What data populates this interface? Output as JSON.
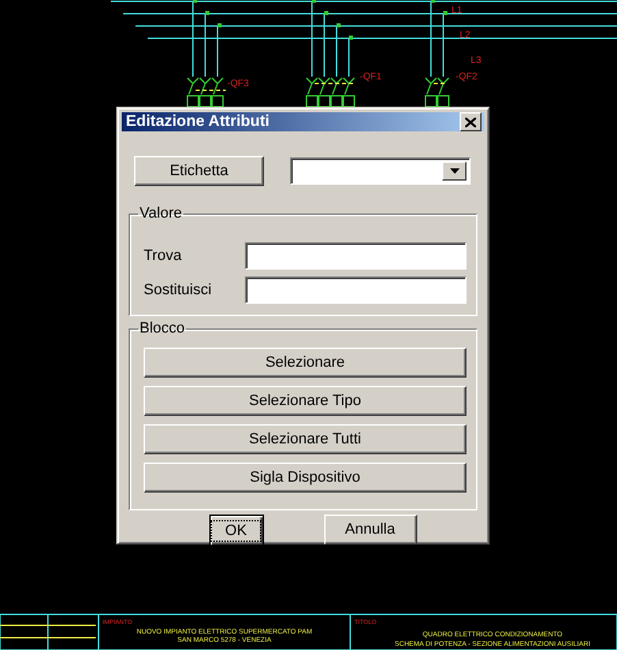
{
  "drawing": {
    "phase_labels": [
      "L1",
      "L2",
      "L3"
    ],
    "breakers": [
      "-QF3",
      "-QF1",
      "-QF2"
    ],
    "title_block": {
      "plant_label": "IMPIANTO",
      "plant": [
        "NUOVO IMPIANTO ELETTRICO SUPERMERCATO PAM",
        "SAN MARCO 5278 - VENEZIA"
      ],
      "title_label": "TITOLO",
      "title": [
        "QUADRO ELETTRICO CONDIZIONAMENTO",
        "SCHEMA DI POTENZA - SEZIONE ALIMENTAZIONI AUSILIARI"
      ]
    }
  },
  "dialog": {
    "title": "Editazione Attributi",
    "label_button": {
      "label": "Etichetta"
    },
    "value_group": {
      "title": "Valore",
      "fields": [
        {
          "label": "Trova"
        },
        {
          "label": "Sostituisci"
        }
      ]
    },
    "block_group": {
      "title": "Blocco",
      "buttons": [
        {
          "label": "Selezionare"
        },
        {
          "label": "Selezionare Tipo"
        },
        {
          "label": "Selezionare Tutti"
        },
        {
          "label": "Sigla Dispositivo"
        }
      ]
    },
    "buttons": [
      {
        "label": "OK",
        "default": true
      },
      {
        "label": "Annulla",
        "default": false
      }
    ]
  }
}
